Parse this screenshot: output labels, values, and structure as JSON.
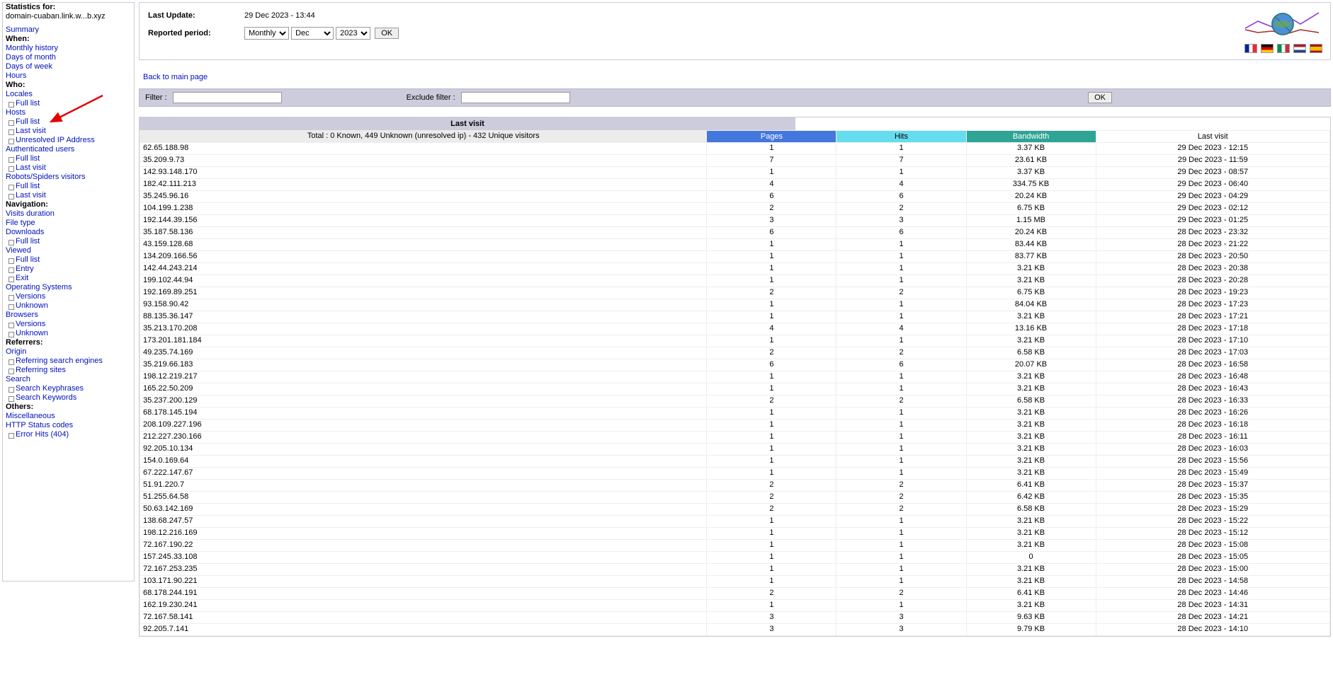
{
  "sidebar": {
    "stats_for_label": "Statistics for:",
    "domain": "domain-cuaban.link.w...b.xyz",
    "nav": {
      "summary": "Summary",
      "when": "When:",
      "monthly_history": "Monthly history",
      "days_of_month": "Days of month",
      "days_of_week": "Days of week",
      "hours": "Hours",
      "who": "Who:",
      "locales": "Locales",
      "full_list": "Full list",
      "hosts": "Hosts",
      "last_visit": "Last visit",
      "unresolved": "Unresolved IP Address",
      "auth_users": "Authenticated users",
      "robots": "Robots/Spiders visitors",
      "navigation": "Navigation:",
      "visits_duration": "Visits duration",
      "file_type": "File type",
      "downloads": "Downloads",
      "viewed": "Viewed",
      "entry": "Entry",
      "exit": "Exit",
      "os": "Operating Systems",
      "versions": "Versions",
      "unknown": "Unknown",
      "browsers": "Browsers",
      "referrers": "Referrers:",
      "origin": "Origin",
      "ref_search_engines": "Referring search engines",
      "ref_sites": "Referring sites",
      "search": "Search",
      "search_keyphrases": "Search Keyphrases",
      "search_keywords": "Search Keywords",
      "others": "Others:",
      "miscellaneous": "Miscellaneous",
      "http_status": "HTTP Status codes",
      "error_hits": "Error Hits (404)"
    }
  },
  "header": {
    "last_update_label": "Last Update:",
    "last_update_value": "29 Dec 2023 - 13:44",
    "reported_period_label": "Reported period:",
    "period_type": "Monthly",
    "month": "Dec",
    "year": "2023",
    "ok": "OK"
  },
  "back_link": "Back to main page",
  "filter": {
    "filter_label": "Filter :",
    "exclude_label": "Exclude filter :",
    "ok": "OK"
  },
  "table": {
    "title": "Last visit",
    "total": "Total : 0 Known, 449 Unknown (unresolved ip) - 432 Unique visitors",
    "headers": {
      "pages": "Pages",
      "hits": "Hits",
      "bandwidth": "Bandwidth",
      "last_visit": "Last visit"
    },
    "rows": [
      {
        "host": "62.65.188.98",
        "pages": "1",
        "hits": "1",
        "bw": "3.37 KB",
        "lv": "29 Dec 2023 - 12:15"
      },
      {
        "host": "35.209.9.73",
        "pages": "7",
        "hits": "7",
        "bw": "23.61 KB",
        "lv": "29 Dec 2023 - 11:59"
      },
      {
        "host": "142.93.148.170",
        "pages": "1",
        "hits": "1",
        "bw": "3.37 KB",
        "lv": "29 Dec 2023 - 08:57"
      },
      {
        "host": "182.42.111.213",
        "pages": "4",
        "hits": "4",
        "bw": "334.75 KB",
        "lv": "29 Dec 2023 - 06:40"
      },
      {
        "host": "35.245.96.16",
        "pages": "6",
        "hits": "6",
        "bw": "20.24 KB",
        "lv": "29 Dec 2023 - 04:29"
      },
      {
        "host": "104.199.1.238",
        "pages": "2",
        "hits": "2",
        "bw": "6.75 KB",
        "lv": "29 Dec 2023 - 02:12"
      },
      {
        "host": "192.144.39.156",
        "pages": "3",
        "hits": "3",
        "bw": "1.15 MB",
        "lv": "29 Dec 2023 - 01:25"
      },
      {
        "host": "35.187.58.136",
        "pages": "6",
        "hits": "6",
        "bw": "20.24 KB",
        "lv": "28 Dec 2023 - 23:32"
      },
      {
        "host": "43.159.128.68",
        "pages": "1",
        "hits": "1",
        "bw": "83.44 KB",
        "lv": "28 Dec 2023 - 21:22"
      },
      {
        "host": "134.209.166.56",
        "pages": "1",
        "hits": "1",
        "bw": "83.77 KB",
        "lv": "28 Dec 2023 - 20:50"
      },
      {
        "host": "142.44.243.214",
        "pages": "1",
        "hits": "1",
        "bw": "3.21 KB",
        "lv": "28 Dec 2023 - 20:38"
      },
      {
        "host": "199.102.44.94",
        "pages": "1",
        "hits": "1",
        "bw": "3.21 KB",
        "lv": "28 Dec 2023 - 20:28"
      },
      {
        "host": "192.169.89.251",
        "pages": "2",
        "hits": "2",
        "bw": "6.75 KB",
        "lv": "28 Dec 2023 - 19:23"
      },
      {
        "host": "93.158.90.42",
        "pages": "1",
        "hits": "1",
        "bw": "84.04 KB",
        "lv": "28 Dec 2023 - 17:23"
      },
      {
        "host": "88.135.36.147",
        "pages": "1",
        "hits": "1",
        "bw": "3.21 KB",
        "lv": "28 Dec 2023 - 17:21"
      },
      {
        "host": "35.213.170.208",
        "pages": "4",
        "hits": "4",
        "bw": "13.16 KB",
        "lv": "28 Dec 2023 - 17:18"
      },
      {
        "host": "173.201.181.184",
        "pages": "1",
        "hits": "1",
        "bw": "3.21 KB",
        "lv": "28 Dec 2023 - 17:10"
      },
      {
        "host": "49.235.74.169",
        "pages": "2",
        "hits": "2",
        "bw": "6.58 KB",
        "lv": "28 Dec 2023 - 17:03"
      },
      {
        "host": "35.219.66.183",
        "pages": "6",
        "hits": "6",
        "bw": "20.07 KB",
        "lv": "28 Dec 2023 - 16:58"
      },
      {
        "host": "198.12.219.217",
        "pages": "1",
        "hits": "1",
        "bw": "3.21 KB",
        "lv": "28 Dec 2023 - 16:48"
      },
      {
        "host": "165.22.50.209",
        "pages": "1",
        "hits": "1",
        "bw": "3.21 KB",
        "lv": "28 Dec 2023 - 16:43"
      },
      {
        "host": "35.237.200.129",
        "pages": "2",
        "hits": "2",
        "bw": "6.58 KB",
        "lv": "28 Dec 2023 - 16:33"
      },
      {
        "host": "68.178.145.194",
        "pages": "1",
        "hits": "1",
        "bw": "3.21 KB",
        "lv": "28 Dec 2023 - 16:26"
      },
      {
        "host": "208.109.227.196",
        "pages": "1",
        "hits": "1",
        "bw": "3.21 KB",
        "lv": "28 Dec 2023 - 16:18"
      },
      {
        "host": "212.227.230.166",
        "pages": "1",
        "hits": "1",
        "bw": "3.21 KB",
        "lv": "28 Dec 2023 - 16:11"
      },
      {
        "host": "92.205.10.134",
        "pages": "1",
        "hits": "1",
        "bw": "3.21 KB",
        "lv": "28 Dec 2023 - 16:03"
      },
      {
        "host": "154.0.169.64",
        "pages": "1",
        "hits": "1",
        "bw": "3.21 KB",
        "lv": "28 Dec 2023 - 15:56"
      },
      {
        "host": "67.222.147.67",
        "pages": "1",
        "hits": "1",
        "bw": "3.21 KB",
        "lv": "28 Dec 2023 - 15:49"
      },
      {
        "host": "51.91.220.7",
        "pages": "2",
        "hits": "2",
        "bw": "6.41 KB",
        "lv": "28 Dec 2023 - 15:37"
      },
      {
        "host": "51.255.64.58",
        "pages": "2",
        "hits": "2",
        "bw": "6.42 KB",
        "lv": "28 Dec 2023 - 15:35"
      },
      {
        "host": "50.63.142.169",
        "pages": "2",
        "hits": "2",
        "bw": "6.58 KB",
        "lv": "28 Dec 2023 - 15:29"
      },
      {
        "host": "138.68.247.57",
        "pages": "1",
        "hits": "1",
        "bw": "3.21 KB",
        "lv": "28 Dec 2023 - 15:22"
      },
      {
        "host": "198.12.216.169",
        "pages": "1",
        "hits": "1",
        "bw": "3.21 KB",
        "lv": "28 Dec 2023 - 15:12"
      },
      {
        "host": "72.167.190.22",
        "pages": "1",
        "hits": "1",
        "bw": "3.21 KB",
        "lv": "28 Dec 2023 - 15:08"
      },
      {
        "host": "157.245.33.108",
        "pages": "1",
        "hits": "1",
        "bw": "0",
        "lv": "28 Dec 2023 - 15:05"
      },
      {
        "host": "72.167.253.235",
        "pages": "1",
        "hits": "1",
        "bw": "3.21 KB",
        "lv": "28 Dec 2023 - 15:00"
      },
      {
        "host": "103.171.90.221",
        "pages": "1",
        "hits": "1",
        "bw": "3.21 KB",
        "lv": "28 Dec 2023 - 14:58"
      },
      {
        "host": "68.178.244.191",
        "pages": "2",
        "hits": "2",
        "bw": "6.41 KB",
        "lv": "28 Dec 2023 - 14:46"
      },
      {
        "host": "162.19.230.241",
        "pages": "1",
        "hits": "1",
        "bw": "3.21 KB",
        "lv": "28 Dec 2023 - 14:31"
      },
      {
        "host": "72.167.58.141",
        "pages": "3",
        "hits": "3",
        "bw": "9.63 KB",
        "lv": "28 Dec 2023 - 14:21"
      },
      {
        "host": "92.205.7.141",
        "pages": "3",
        "hits": "3",
        "bw": "9.79 KB",
        "lv": "28 Dec 2023 - 14:10"
      }
    ]
  }
}
